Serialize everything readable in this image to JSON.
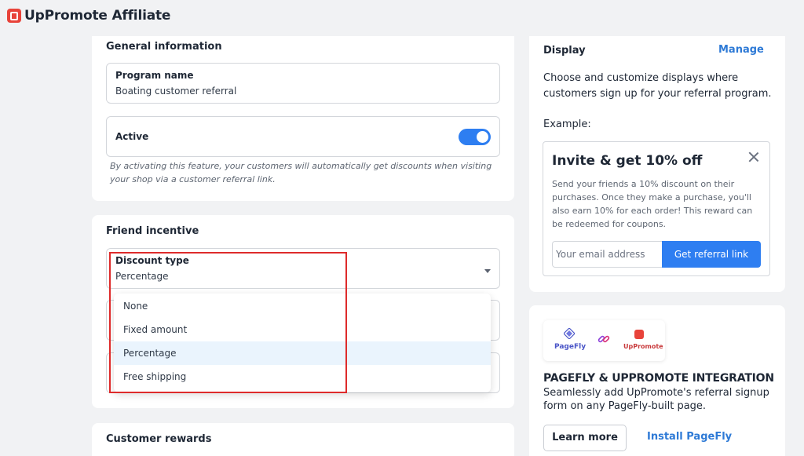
{
  "app": {
    "title": "UpPromote Affiliate",
    "logo_icon": "uppromote-logo-icon"
  },
  "general": {
    "title": "General information",
    "program_name_label": "Program name",
    "program_name_value": "Boating customer referral",
    "active_label": "Active",
    "active_on": true,
    "help_text_line1": "By activating this feature, your customers will automatically get discounts when visiting",
    "help_text_line2": "your shop via a customer referral link."
  },
  "friend": {
    "title": "Friend incentive",
    "discount_type_label": "Discount type",
    "discount_type_value": "Percentage",
    "options": [
      {
        "label": "None",
        "selected": false
      },
      {
        "label": "Fixed amount",
        "selected": false
      },
      {
        "label": "Percentage",
        "selected": true
      },
      {
        "label": "Free shipping",
        "selected": false
      }
    ]
  },
  "rewards": {
    "title": "Customer rewards"
  },
  "display": {
    "title": "Display",
    "manage_link": "Manage",
    "description_line1": "Choose and customize displays where",
    "description_line2": "customers sign up for your referral program.",
    "example_label": "Example:",
    "preview": {
      "title": "Invite & get 10% off",
      "desc_line1": "Send your friends a 10% discount on their",
      "desc_line2": "purchases. Once they make a purchase, you'll",
      "desc_line3": "also earn 10% for each order! This reward can",
      "desc_line4": "be redeemed for coupons.",
      "email_placeholder": "Your email address",
      "button_label": "Get referral link"
    }
  },
  "integration": {
    "pagefly_label": "PageFly",
    "uppromote_label": "UpPromote",
    "title": "PAGEFLY & UPPROMOTE INTEGRATION",
    "desc_line1": "Seamlessly add UpPromote's referral signup",
    "desc_line2": "form on any PageFly-built page.",
    "learn_more": "Learn more",
    "install": "Install PageFly"
  },
  "colors": {
    "accent": "#2e7ef1",
    "highlight_border": "#de2b2b",
    "brand": "#e8433a",
    "selected_option": "#eaf4fd"
  }
}
